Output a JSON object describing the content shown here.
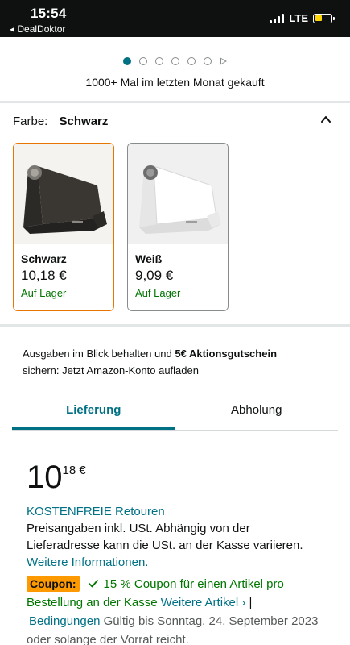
{
  "status_bar": {
    "time": "15:54",
    "back_app": "◂ DealDoktor",
    "network": "LTE"
  },
  "carousel": {
    "dot_count": 6,
    "active_index": 0,
    "bought_text": "1000+ Mal im letzten Monat gekauft"
  },
  "color_selection": {
    "label": "Farbe:",
    "selected": "Schwarz",
    "options": [
      {
        "name": "Schwarz",
        "price": "10,18 €",
        "stock": "Auf Lager",
        "color": "#3a3733"
      },
      {
        "name": "Weiß",
        "price": "9,09 €",
        "stock": "Auf Lager",
        "color": "#f2f2f2"
      }
    ]
  },
  "promo": {
    "text_before": "Ausgaben im Blick behalten und ",
    "bold": "5€ Aktionsgutschein",
    "text_after": "sichern: Jetzt Amazon-Konto aufladen"
  },
  "tabs": [
    {
      "label": "Lieferung",
      "active": true
    },
    {
      "label": "Abholung",
      "active": false
    }
  ],
  "price": {
    "whole": "10",
    "fraction": "18 €"
  },
  "delivery": {
    "free_returns": "KOSTENFREIE Retouren",
    "tax_note": "Preisangaben inkl. USt. Abhängig von der Lieferadresse kann die USt. an der Kasse variieren.",
    "more_info": "Weitere Informationen."
  },
  "coupon": {
    "badge": "Coupon:",
    "text": "15 % Coupon für einen Artikel pro Bestellung an der Kasse",
    "more_items": "Weitere Artikel ›",
    "separator": "|",
    "conditions": "Bedingungen",
    "validity": "Gültig bis Sonntag, 24. September 2023 oder solange der Vorrat reicht."
  },
  "colors": {
    "link": "#007185",
    "in_stock": "#007600",
    "selected_border": "#e77600",
    "coupon_badge": "#ff9900"
  }
}
